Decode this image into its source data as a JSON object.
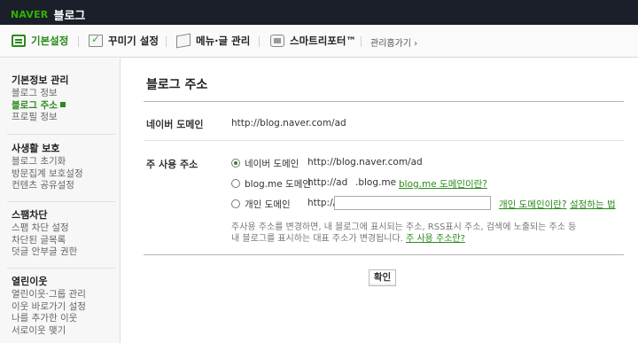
{
  "header": {
    "brand": "NAVER",
    "service": "블로그"
  },
  "menubar": {
    "items": [
      {
        "label": "기본설정",
        "icon": "basic-settings-icon"
      },
      {
        "label": "꾸미기 설정",
        "icon": "decorate-icon"
      },
      {
        "label": "메뉴·글 관리",
        "icon": "menu-posts-icon"
      },
      {
        "label": "스마트리포터™",
        "icon": "smart-reporter-icon"
      }
    ],
    "manage_label": "관리홈가기 ›"
  },
  "sidebar": {
    "groups": [
      {
        "title": "기본정보 관리",
        "items": [
          "블로그 정보",
          "블로그 주소",
          "프로필 정보"
        ]
      },
      {
        "title": "사생활 보호",
        "items": [
          "블로그 초기화",
          "방문집계 보호설정",
          "컨텐츠 공유설정"
        ]
      },
      {
        "title": "스팸차단",
        "items": [
          "스팸 차단 설정",
          "차단된 글목록",
          "덧글 안부글 권한"
        ]
      },
      {
        "title": "열린이웃",
        "items": [
          "열린이웃·그룹 관리",
          "이웃 바로가기 설정",
          "나를 추가한 이웃",
          "서로이웃 맺기"
        ]
      }
    ],
    "active_item": "블로그 주소"
  },
  "main": {
    "title": "블로그 주소",
    "naver_domain": {
      "label": "네이버 도메인",
      "value": "http://blog.naver.com/ad"
    },
    "main_address": {
      "label": "주 사용 주소",
      "option_naver": {
        "label": "네이버 도메인",
        "value": "http://blog.naver.com/ad",
        "checked": true
      },
      "option_blogme": {
        "label": "blog.me 도메인",
        "prefix": "http://ad",
        "suffix": ".blog.me",
        "link": "blog.me 도메인이란?"
      },
      "option_personal": {
        "label": "개인 도메인",
        "prefix": "http://",
        "input_value": "",
        "link1": "개인 도메인이란?",
        "link2": "설정하는 법"
      }
    },
    "help_line1": "주사용 주소를 변경하면, 내 블로그에 표시되는 주소, RSS표시 주소, 검색에 노출되는 주소 등",
    "help_line2": "내 블로그를 표시하는 대표 주소가 변경됩니다.",
    "help_link": "주 사용 주소란?",
    "confirm_label": "확인"
  },
  "colors": {
    "topbar": "#1b1f2a",
    "brand_green": "#2db400",
    "accent": "#2a8a1a"
  }
}
